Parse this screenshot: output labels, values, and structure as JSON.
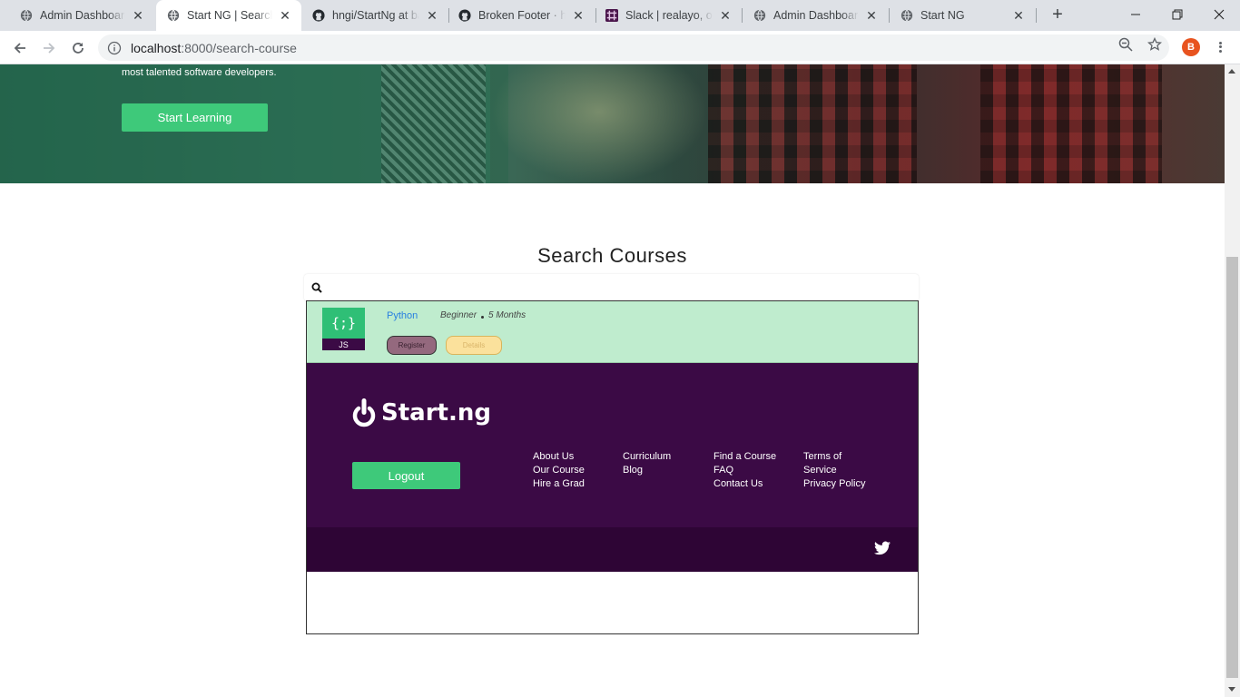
{
  "browser": {
    "tabs": [
      {
        "label": "Admin Dashboard",
        "icon": "globe-icon",
        "active": false
      },
      {
        "label": "Start NG | Search",
        "icon": "globe-icon",
        "active": true
      },
      {
        "label": "hngi/StartNg at ba",
        "icon": "github-icon",
        "active": false
      },
      {
        "label": "Broken Footer · hn",
        "icon": "github-icon",
        "active": false
      },
      {
        "label": "Slack | realayo, oye",
        "icon": "slack-icon",
        "active": false
      },
      {
        "label": "Admin Dashboard",
        "icon": "globe-icon",
        "active": false
      },
      {
        "label": "Start NG",
        "icon": "globe-icon",
        "active": false
      }
    ],
    "close_glyph": "✕",
    "new_tab_glyph": "+",
    "url_host": "localhost",
    "url_path": ":8000/search-course",
    "profile_initial": "B"
  },
  "hero": {
    "tagline": "most talented software developers.",
    "cta_label": "Start Learning"
  },
  "search": {
    "title": "Search Courses",
    "placeholder": "",
    "value": ""
  },
  "course": {
    "logo_symbol": "{;}",
    "logo_caption": "JS",
    "name": "Python",
    "level": "Beginner",
    "duration": "5 Months",
    "register_label": "Register",
    "details_label": "Details"
  },
  "footer": {
    "brand": "Start.ng",
    "logout_label": "Logout",
    "columns": [
      [
        "About Us",
        "Our Course",
        "Hire a Grad"
      ],
      [
        "Curriculum",
        "Blog"
      ],
      [
        "Find a Course",
        "FAQ",
        "Contact Us"
      ],
      [
        "Terms of",
        "Service",
        "Privacy Policy"
      ]
    ],
    "social": [
      "twitter-icon"
    ]
  },
  "colors": {
    "accent_green": "#3ec97a",
    "footer_purple": "#3b0a45",
    "footer_bottom": "#2e0535",
    "card_bg": "#bfecce",
    "link_blue": "#2980e0"
  }
}
